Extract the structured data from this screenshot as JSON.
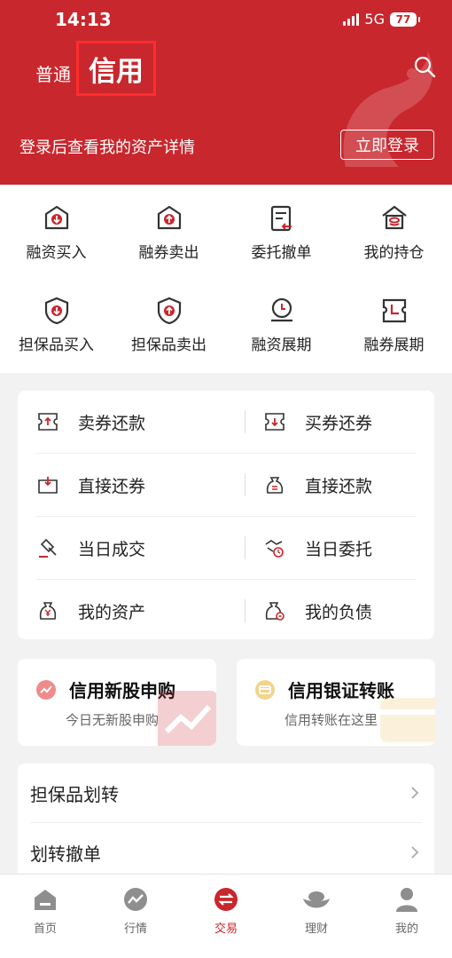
{
  "status": {
    "time": "14:13",
    "network": "5G",
    "battery": "77"
  },
  "header": {
    "tab_normal": "普通",
    "tab_credit": "信用",
    "login_tip": "登录后查看我的资产详情",
    "login_button": "立即登录"
  },
  "quick_actions": [
    {
      "label": "融资买入",
      "icon": "shield-in-icon"
    },
    {
      "label": "融券卖出",
      "icon": "house-out-icon"
    },
    {
      "label": "委托撤单",
      "icon": "doc-cancel-icon"
    },
    {
      "label": "我的持仓",
      "icon": "home-stack-icon"
    },
    {
      "label": "担保品买入",
      "icon": "shield-down-icon"
    },
    {
      "label": "担保品卖出",
      "icon": "shield-up-icon"
    },
    {
      "label": "融资展期",
      "icon": "clock-hand-icon"
    },
    {
      "label": "融券展期",
      "icon": "ticket-clock-icon"
    }
  ],
  "grid": [
    {
      "left": {
        "label": "卖券还款",
        "icon": "ticket-up-icon"
      },
      "right": {
        "label": "买券还券",
        "icon": "ticket-down-icon"
      }
    },
    {
      "left": {
        "label": "直接还券",
        "icon": "return-ticket-icon"
      },
      "right": {
        "label": "直接还款",
        "icon": "money-bag-icon"
      }
    },
    {
      "left": {
        "label": "当日成交",
        "icon": "gavel-icon"
      },
      "right": {
        "label": "当日委托",
        "icon": "handshake-icon"
      }
    },
    {
      "left": {
        "label": "我的资产",
        "icon": "yen-bag-icon"
      },
      "right": {
        "label": "我的负债",
        "icon": "debt-bag-icon"
      }
    }
  ],
  "promos": [
    {
      "title": "信用新股申购",
      "subtitle": "今日无新股申购"
    },
    {
      "title": "信用银证转账",
      "subtitle": "信用转账在这里"
    }
  ],
  "list": [
    {
      "label": "担保品划转"
    },
    {
      "label": "划转撤单"
    }
  ],
  "tabbar": [
    {
      "label": "首页",
      "icon": "home-icon"
    },
    {
      "label": "行情",
      "icon": "chart-icon"
    },
    {
      "label": "交易",
      "icon": "trade-icon",
      "active": true
    },
    {
      "label": "理财",
      "icon": "ingot-icon"
    },
    {
      "label": "我的",
      "icon": "person-icon"
    }
  ],
  "colors": {
    "brand": "#c8272d",
    "text": "#222222",
    "muted": "#666666"
  }
}
